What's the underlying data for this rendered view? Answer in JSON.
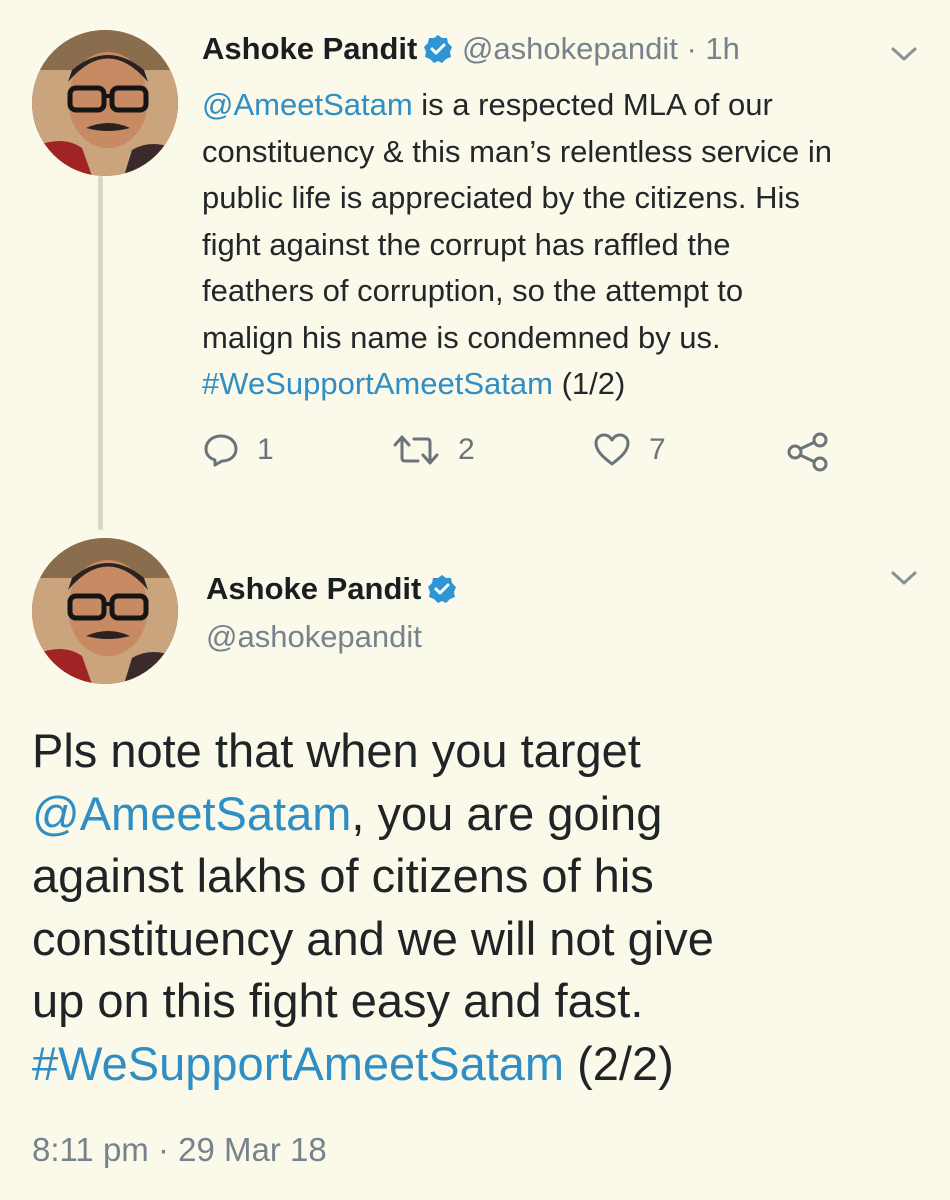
{
  "tweet1": {
    "author_name": "Ashoke Pandit",
    "handle": "@ashokepandit",
    "time": "· 1h",
    "mention": "@AmeetSatam",
    "text_lines": [
      " is a respected MLA of our",
      "constituency & this man’s relentless service in",
      "public life is appreciated by the citizens. His",
      "fight against the corrupt has raffled the",
      "feathers of corruption, so the attempt to",
      "malign his name is condemned by us."
    ],
    "hashtag": "#WeSupportAmeetSatam",
    "suffix": " (1/2)",
    "replies": "1",
    "retweets": "2",
    "likes": "7"
  },
  "tweet2": {
    "author_name": "Ashoke Pandit",
    "handle": "@ashokepandit",
    "line1": "Pls note that when you target",
    "mention": "@AmeetSatam",
    "line2_rest": ", you are going",
    "line3": "against lakhs of citizens of his",
    "line4": "constituency and we will not give",
    "line5": "up on this fight easy and fast.",
    "hashtag": "#WeSupportAmeetSatam",
    "suffix": " (2/2)",
    "timestamp": "8:11 pm · 29 Mar 18"
  },
  "colors": {
    "background": "#fbf9e9",
    "link": "#2f8fc4",
    "verified": "#2f96d6",
    "muted": "#77838c"
  },
  "icons": [
    "verified-badge-icon",
    "chevron-down-icon",
    "reply-icon",
    "retweet-icon",
    "like-heart-icon",
    "share-icon"
  ]
}
